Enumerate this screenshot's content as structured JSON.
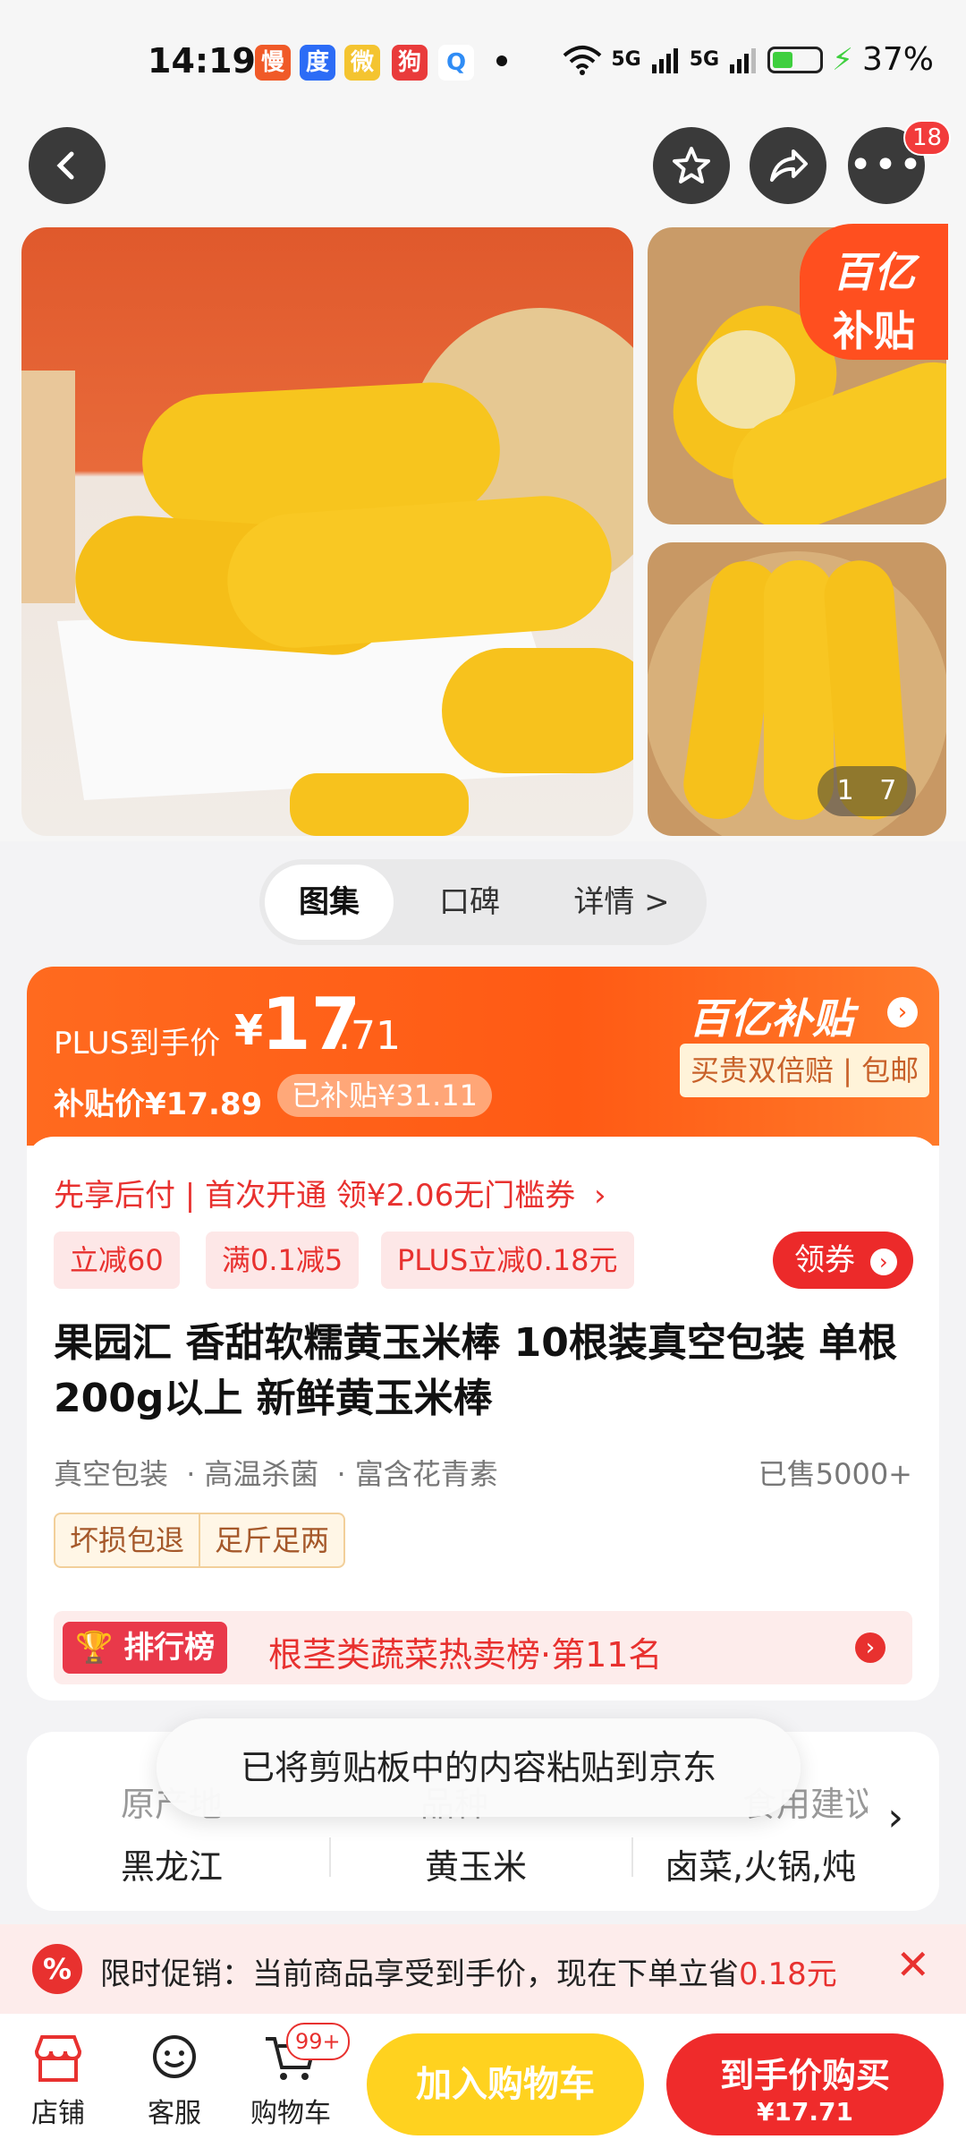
{
  "status_bar": {
    "time": "14:19",
    "network_1": "5G",
    "network_2": "5G",
    "battery_percent": "37%"
  },
  "header": {
    "more_badge": "18"
  },
  "gallery": {
    "subsidy_badge_line1": "百亿",
    "subsidy_badge_line2": "补贴",
    "page_current": "1",
    "page_total": "7"
  },
  "tabs": [
    {
      "label": "图集"
    },
    {
      "label": "口碑"
    },
    {
      "label": "详情 >"
    }
  ],
  "price": {
    "plus_label": "PLUS到手价",
    "currency": "¥",
    "plus_int": "17",
    "plus_dec": ".71",
    "subsidy_price": "补贴价¥17.89",
    "subsidized": "已补贴¥31.11",
    "brand_tag": "百亿补贴",
    "guarantee": "买贵双倍赔 | 包邮"
  },
  "promo_line": "先享后付 | 首次开通 领¥2.06无门槛券",
  "coupons": [
    "立减60",
    "满0.1减5",
    "PLUS立减0.18元"
  ],
  "coupon_button": "领券",
  "product": {
    "title": "果园汇 香甜软糯黄玉米棒 10根装真空包装 单根200g以上 新鲜黄玉米棒",
    "features": [
      "真空包装",
      "高温杀菌",
      "富含花青素"
    ],
    "sold": "已售5000+",
    "services": [
      "坏损包退",
      "足斤足两"
    ]
  },
  "ranking": {
    "tag": "排行榜",
    "text": "根茎类蔬菜热卖榜·第11名"
  },
  "specs": {
    "labels": [
      "原产地",
      "品种",
      "食用建议"
    ],
    "values": [
      "黑龙江",
      "黄玉米",
      "卤菜,火锅,炖"
    ]
  },
  "toast": "已将剪贴板中的内容粘贴到京东",
  "promo_bar": {
    "text": "限时促销：当前商品享受到手价，现在下单立省",
    "amount": "0.18元"
  },
  "bottom_nav": {
    "shop": "店铺",
    "service": "客服",
    "cart": "购物车",
    "cart_badge": "99+",
    "add_cart": "加入购物车",
    "buy": "到手价购买",
    "buy_price": "¥17.71"
  },
  "colors": {
    "accent": "#ff5a14",
    "red": "#e8312f",
    "yellow_button": "#ffd21f",
    "buy_button": "#ef2b2b"
  }
}
